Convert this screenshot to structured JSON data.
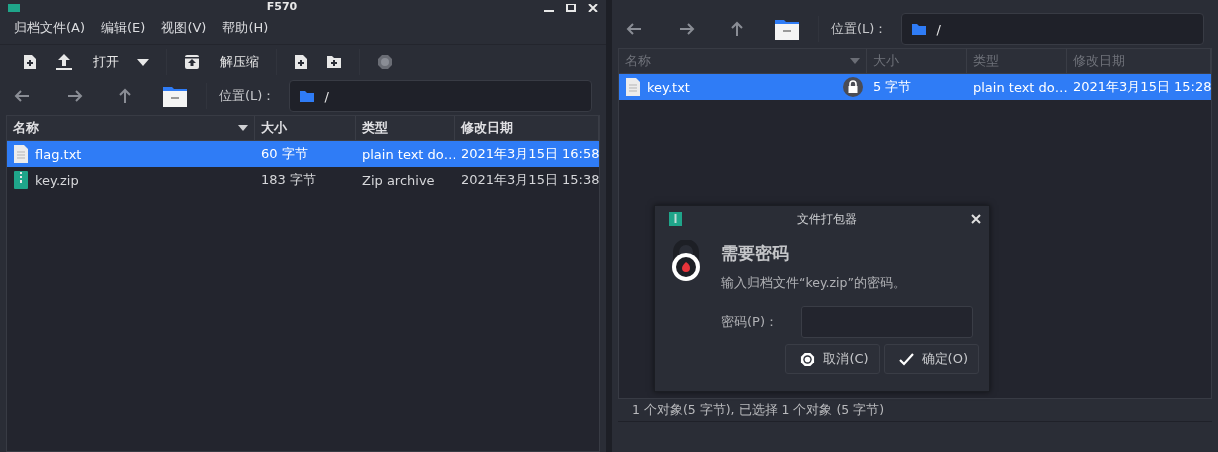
{
  "left_window": {
    "title": "F570",
    "menu": [
      "归档文件(A)",
      "编辑(E)",
      "视图(V)",
      "帮助(H)"
    ],
    "toolbar": [
      {
        "kind": "new-file",
        "disabled": false
      },
      {
        "kind": "open",
        "label": "打开",
        "disabled": false
      },
      {
        "kind": "dropdown",
        "disabled": false
      },
      {
        "kind": "extract",
        "label": "解压缩",
        "disabled": false
      },
      {
        "kind": "add-file",
        "disabled": false
      },
      {
        "kind": "add-folder",
        "disabled": false
      },
      {
        "kind": "stop",
        "disabled": true
      }
    ],
    "location_label": "位置(L)：",
    "path": "/",
    "table": {
      "dimmed": false,
      "columns": [
        "名称",
        "大小",
        "类型",
        "修改日期"
      ],
      "rows": [
        {
          "kind": "text",
          "name": "flag.txt",
          "size": "60 字节",
          "type": "plain text do…",
          "modified": "2021年3月15日 16:58",
          "selected": true,
          "locked": false
        },
        {
          "kind": "zip",
          "name": "key.zip",
          "size": "183 字节",
          "type": "Zip archive",
          "modified": "2021年3月15日 15:38",
          "selected": false,
          "locked": false
        }
      ]
    }
  },
  "right_window": {
    "location_label": "位置(L)：",
    "path": "/",
    "table": {
      "dimmed": true,
      "columns": [
        "名称",
        "大小",
        "类型",
        "修改日期"
      ],
      "rows": [
        {
          "kind": "text",
          "name": "key.txt",
          "size": "5 字节",
          "type": "plain text do…",
          "modified": "2021年3月15日 15:28",
          "selected": true,
          "locked": true
        }
      ]
    },
    "status_bar": "1 个对象(5 字节), 已选择 1 个对象 (5 字节)"
  },
  "dialog": {
    "title": "文件打包器",
    "heading": "需要密码",
    "message": "输入归档文件“key.zip”的密码。",
    "field_label": "密码(P)：",
    "buttons": [
      {
        "kind": "cancel",
        "label": "取消(C)"
      },
      {
        "kind": "ok",
        "label": "确定(O)"
      }
    ]
  }
}
